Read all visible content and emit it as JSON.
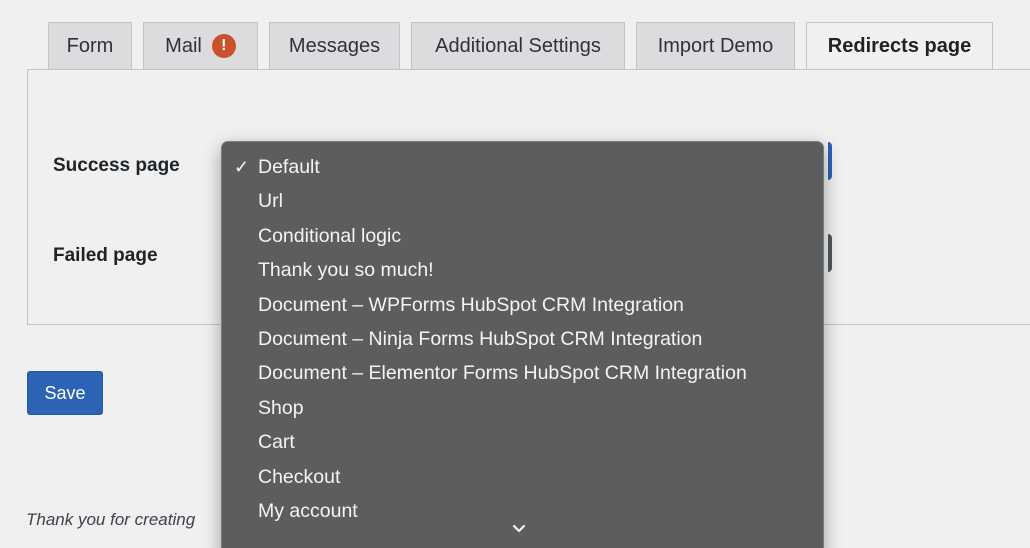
{
  "tabs": [
    {
      "label": "Form"
    },
    {
      "label": "Mail",
      "badge": "!"
    },
    {
      "label": "Messages"
    },
    {
      "label": "Additional Settings"
    },
    {
      "label": "Import Demo"
    },
    {
      "label": "Redirects page",
      "active": true
    }
  ],
  "fields": {
    "success_label": "Success page",
    "failed_label": "Failed page"
  },
  "save_label": "Save",
  "footer_text": "Thank you for creating",
  "dropdown": {
    "selected": "Default",
    "options": [
      "Default",
      "Url",
      "Conditional logic",
      "Thank you so much!",
      "Document – WPForms HubSpot CRM Integration",
      "Document – Ninja Forms HubSpot CRM Integration",
      "Document – Elementor Forms HubSpot CRM Integration",
      "Shop",
      "Cart",
      "Checkout",
      "My account"
    ]
  },
  "colors": {
    "accent": "#2c63b5",
    "warning": "#c9512b",
    "menu_bg": "#5b5d5e"
  }
}
